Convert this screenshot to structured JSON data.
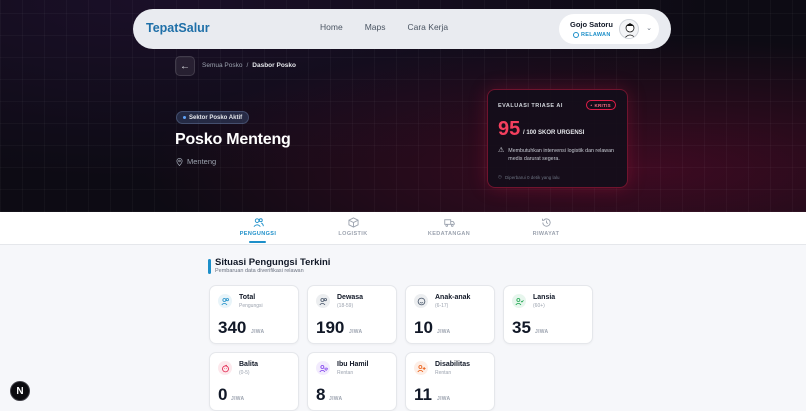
{
  "navbar": {
    "brand": "TepatSalur",
    "links": [
      "Home",
      "Maps",
      "Cara Kerja"
    ],
    "user": {
      "name": "Gojo Satoru",
      "role": "RELAWAN"
    }
  },
  "breadcrumb": {
    "back_icon": "arrow-left-icon",
    "root": "Semua Posko",
    "separator": "/",
    "current": "Dasbor Posko"
  },
  "hero": {
    "sector_badge": "Sektor Posko Aktif",
    "title": "Posko Menteng",
    "location": "Menteng"
  },
  "triage": {
    "label": "EVALUASI TRIASE AI",
    "badge": "KRITIS",
    "score": "95",
    "score_suffix": "/ 100 SKOR URGENSI",
    "warning": "Membutuhkan intervensi logistik dan relawan medis darurat segera.",
    "updated": "Diperbarui 0 detik yang lalu"
  },
  "tabs": [
    {
      "label": "PENGUNGSI",
      "icon": "users-icon",
      "active": true
    },
    {
      "label": "LOGISTIK",
      "icon": "box-icon",
      "active": false
    },
    {
      "label": "KEDATANGAN",
      "icon": "truck-icon",
      "active": false
    },
    {
      "label": "RIWAYAT",
      "icon": "history-icon",
      "active": false
    }
  ],
  "section": {
    "title": "Situasi Pengungsi Terkini",
    "subtitle": "Pembaruan data diverifikasi relawan"
  },
  "stats": [
    {
      "title": "Total",
      "sub": "Pengungsi",
      "value": "340",
      "unit": "JIWA",
      "icon": "users-icon",
      "color": "#1d8fc9"
    },
    {
      "title": "Dewasa",
      "sub": "(18-59)",
      "value": "190",
      "unit": "JIWA",
      "icon": "users-icon",
      "color": "#475569"
    },
    {
      "title": "Anak-anak",
      "sub": "(6-17)",
      "value": "10",
      "unit": "JIWA",
      "icon": "smile-icon",
      "color": "#475569"
    },
    {
      "title": "Lansia",
      "sub": "(60+)",
      "value": "35",
      "unit": "JIWA",
      "icon": "user-check-icon",
      "color": "#16a34a"
    },
    {
      "title": "Balita",
      "sub": "(0-5)",
      "value": "0",
      "unit": "JIWA",
      "icon": "baby-icon",
      "color": "#e11d48"
    },
    {
      "title": "Ibu Hamil",
      "sub": "Rentan",
      "value": "8",
      "unit": "JIWA",
      "icon": "user-heart-icon",
      "color": "#7c3aed"
    },
    {
      "title": "Disabilitas",
      "sub": "Rentan",
      "value": "11",
      "unit": "JIWA",
      "icon": "accessibility-icon",
      "color": "#ea580c"
    }
  ],
  "dev_button": "N"
}
